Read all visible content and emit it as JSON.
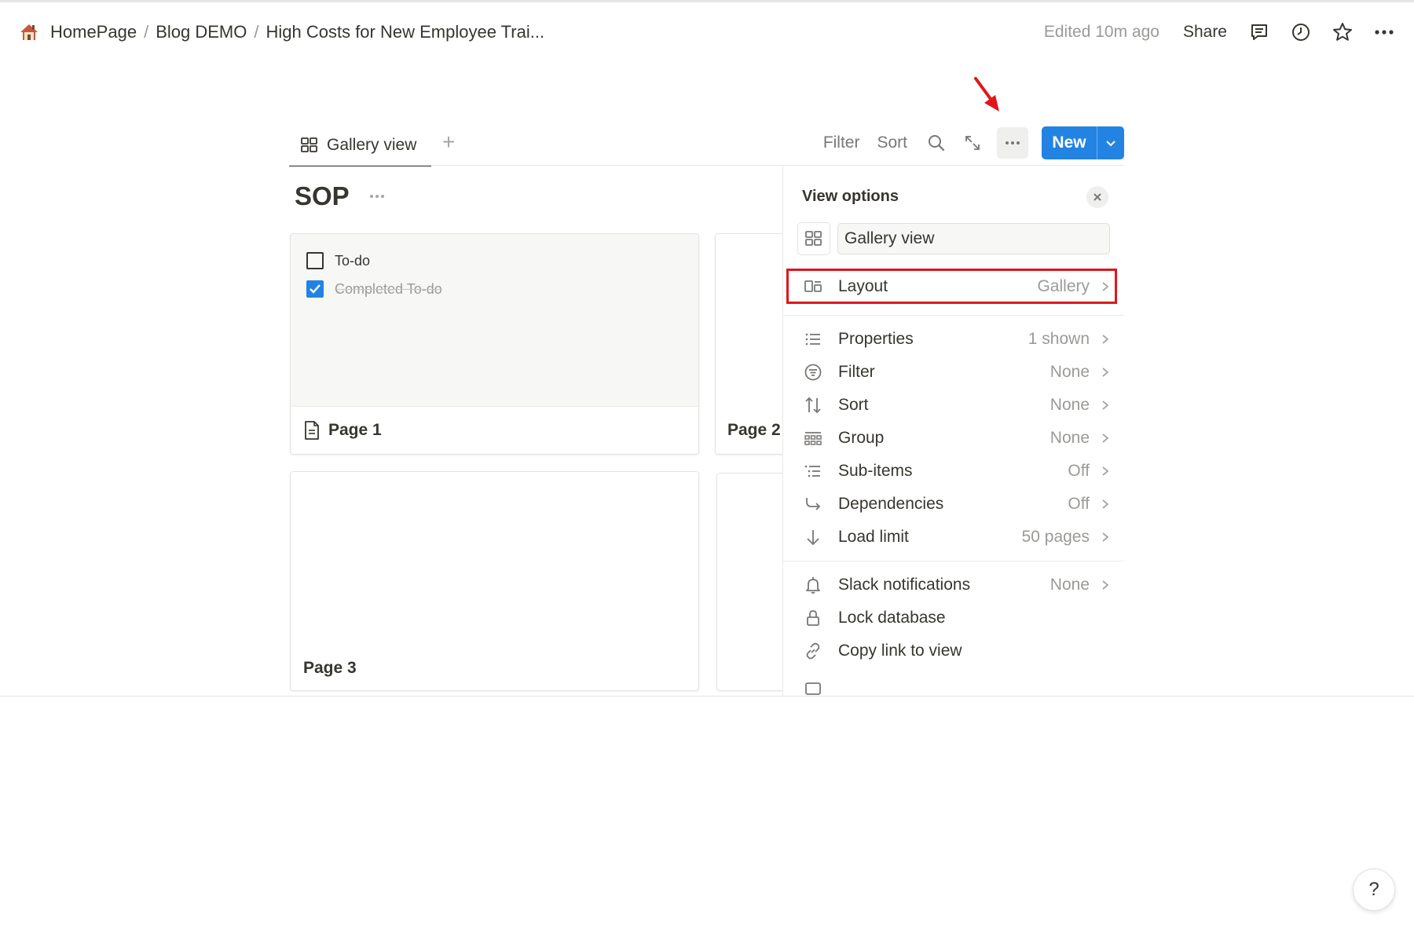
{
  "breadcrumb": {
    "items": [
      "HomePage",
      "Blog DEMO",
      "High Costs for New Employee Trai..."
    ],
    "separator": "/"
  },
  "topbar": {
    "edited": "Edited 10m ago",
    "share": "Share",
    "icons": [
      "comment-icon",
      "clock-icon",
      "star-icon",
      "more-icon"
    ]
  },
  "viewbar": {
    "active_tab": "Gallery view",
    "add_tab": "+",
    "filter": "Filter",
    "sort": "Sort",
    "new_button": "New"
  },
  "database": {
    "title": "SOP"
  },
  "cards": [
    {
      "title": "Page 1",
      "todos": [
        {
          "label": "To-do",
          "checked": false
        },
        {
          "label": "Completed To-do",
          "checked": true
        }
      ]
    },
    {
      "title": "Page 2"
    },
    {
      "title": "Page 3"
    },
    {
      "title": ""
    }
  ],
  "view_options": {
    "heading": "View options",
    "view_name": "Gallery view",
    "items": [
      {
        "label": "Layout",
        "value": "Gallery"
      },
      {
        "label": "Properties",
        "value": "1 shown"
      },
      {
        "label": "Filter",
        "value": "None"
      },
      {
        "label": "Sort",
        "value": "None"
      },
      {
        "label": "Group",
        "value": "None"
      },
      {
        "label": "Sub-items",
        "value": "Off"
      },
      {
        "label": "Dependencies",
        "value": "Off"
      },
      {
        "label": "Load limit",
        "value": "50 pages"
      },
      {
        "label": "Slack notifications",
        "value": "None"
      },
      {
        "label": "Lock database",
        "value": ""
      },
      {
        "label": "Copy link to view",
        "value": ""
      }
    ]
  },
  "help": "?",
  "colors": {
    "accent": "#2383e2",
    "annotation_red": "#e0161b",
    "text": "#37352f",
    "muted": "#9b9a97"
  }
}
